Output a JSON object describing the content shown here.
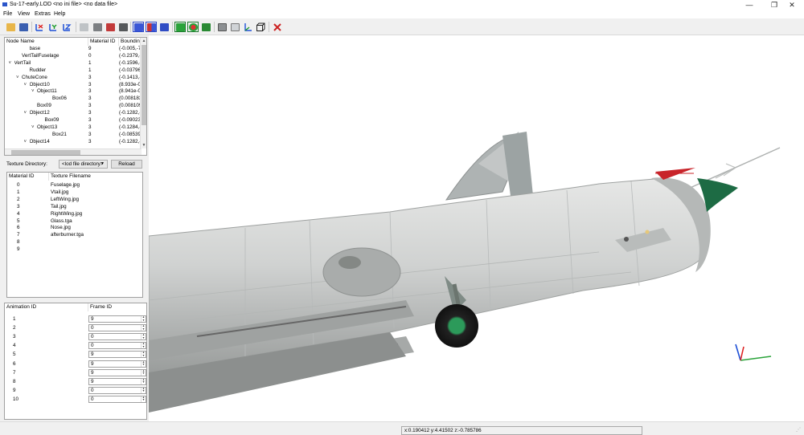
{
  "window": {
    "title": "Su-17-early.LOD  <no ini file>  <no data file>",
    "minimize_glyph": "—",
    "maximize_glyph": "❐",
    "close_glyph": "✕"
  },
  "menu": [
    "File",
    "View",
    "Extras",
    "Help"
  ],
  "toolbar": {
    "icons": [
      "open-icon",
      "save-icon",
      "axis-x-icon",
      "axis-y-icon",
      "axis-z-icon",
      "shade-light-icon",
      "shade-gray-icon",
      "shade-red-icon",
      "shade-dark-icon",
      "view-box-blue-icon",
      "view-box-split-icon",
      "view-cube-blue-icon",
      "render-green-icon",
      "render-sphere-icon",
      "render-texture-icon",
      "wireframe-gray-icon",
      "wireframe-light-icon",
      "axes-icon",
      "bounding-box-icon",
      "tools-icon"
    ]
  },
  "node_tree": {
    "columns": [
      "Node Name",
      "Material ID",
      "Boundin"
    ],
    "rows": [
      {
        "indent": 3,
        "expander": "",
        "name": "base",
        "material": "9",
        "bounds": "(-0.005,-7"
      },
      {
        "indent": 2,
        "expander": "",
        "name": "VertTailFuselage",
        "material": "0",
        "bounds": "(-0.2379,-"
      },
      {
        "indent": 1,
        "expander": "v",
        "name": "VertTail",
        "material": "1",
        "bounds": "(-0.1596,-"
      },
      {
        "indent": 3,
        "expander": "",
        "name": "Rudder",
        "material": "1",
        "bounds": "(-0.03796,"
      },
      {
        "indent": 2,
        "expander": "v",
        "name": "ChuteCone",
        "material": "3",
        "bounds": "(-0.1413,-"
      },
      {
        "indent": 3,
        "expander": "v",
        "name": "Object10",
        "material": "3",
        "bounds": "(8.933e-0"
      },
      {
        "indent": 4,
        "expander": "v",
        "name": "Object11",
        "material": "3",
        "bounds": "(8.941e-0"
      },
      {
        "indent": 6,
        "expander": "",
        "name": "Box06",
        "material": "3",
        "bounds": "(0.008183"
      },
      {
        "indent": 4,
        "expander": "",
        "name": "Box09",
        "material": "3",
        "bounds": "(0.008109"
      },
      {
        "indent": 3,
        "expander": "v",
        "name": "Object12",
        "material": "3",
        "bounds": "(-0.1282,-"
      },
      {
        "indent": 5,
        "expander": "",
        "name": "Box09",
        "material": "3",
        "bounds": "(-0.09023,"
      },
      {
        "indent": 4,
        "expander": "v",
        "name": "Object13",
        "material": "3",
        "bounds": "(-0.1284,-"
      },
      {
        "indent": 6,
        "expander": "",
        "name": "Box21",
        "material": "3",
        "bounds": "(-0.08539,"
      },
      {
        "indent": 3,
        "expander": "v",
        "name": "Object14",
        "material": "3",
        "bounds": "(-0.1282,-"
      }
    ]
  },
  "texture": {
    "directory_label": "Texture Directory:",
    "directory_value": "<lod file directory>",
    "reload_label": "Reload",
    "columns": [
      "Material ID",
      "Texture Filename"
    ],
    "rows": [
      {
        "id": "0",
        "file": "Fuselage.jpg"
      },
      {
        "id": "1",
        "file": "Vtail.jpg"
      },
      {
        "id": "2",
        "file": "LeftWing.jpg"
      },
      {
        "id": "3",
        "file": "Tail.jpg"
      },
      {
        "id": "4",
        "file": "RightWing.jpg"
      },
      {
        "id": "5",
        "file": "Glass.tga"
      },
      {
        "id": "6",
        "file": "Nose.jpg"
      },
      {
        "id": "7",
        "file": "afterburner.tga"
      },
      {
        "id": "8",
        "file": ""
      },
      {
        "id": "9",
        "file": ""
      }
    ]
  },
  "animation": {
    "columns": [
      "Animation ID",
      "Frame ID"
    ],
    "rows": [
      {
        "id": "1",
        "frame": "9"
      },
      {
        "id": "2",
        "frame": "0"
      },
      {
        "id": "3",
        "frame": "0"
      },
      {
        "id": "4",
        "frame": "0"
      },
      {
        "id": "5",
        "frame": "9"
      },
      {
        "id": "6",
        "frame": "9"
      },
      {
        "id": "7",
        "frame": "9"
      },
      {
        "id": "8",
        "frame": "9"
      },
      {
        "id": "9",
        "frame": "0"
      },
      {
        "id": "10",
        "frame": "0"
      }
    ]
  },
  "status": {
    "coords": "x:0.190412 y:4.41502 z:-0.785786"
  },
  "colors": {
    "fuselage": "#c9ccca",
    "nose_cone": "#1d6b44",
    "accent_red": "#c8242a"
  }
}
